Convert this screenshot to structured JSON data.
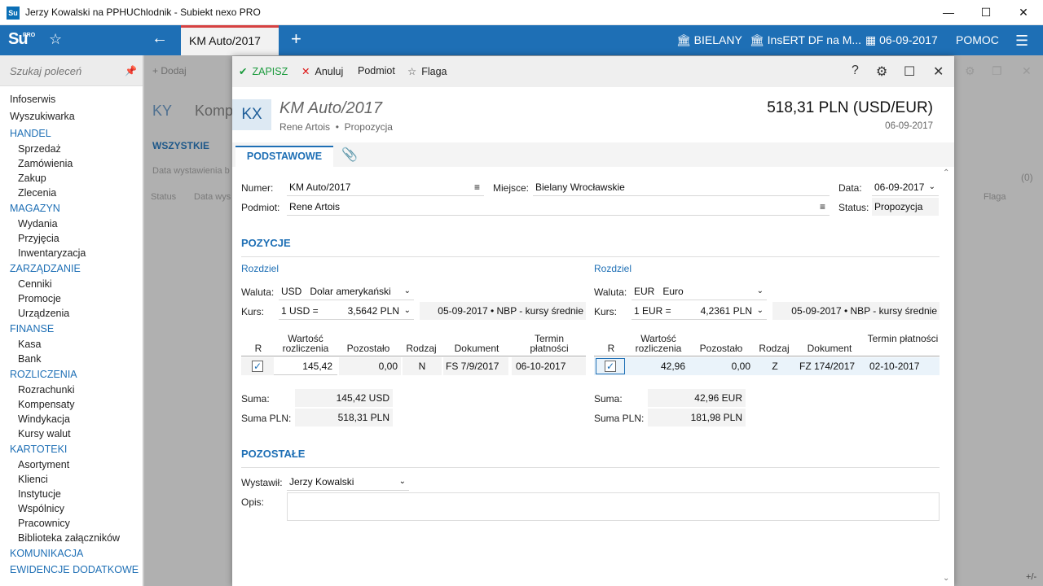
{
  "window": {
    "title": "Jerzy Kowalski na PPHUChlodnik - Subiekt nexo PRO",
    "app_icon": "Su",
    "controls": {
      "minimize": "—",
      "maximize": "☐",
      "close": "✕"
    }
  },
  "header": {
    "logo": "Su",
    "logo_sup": "PRO",
    "active_tab": "KM Auto/2017",
    "location": "BIELANY",
    "company": "InsERT DF na M...",
    "date": "06-09-2017",
    "help": "POMOC"
  },
  "sidebar": {
    "search_placeholder": "Szukaj poleceń",
    "items": [
      {
        "label": "Infoserwis",
        "kind": "top"
      },
      {
        "label": "Wyszukiwarka",
        "kind": "top"
      },
      {
        "label": "HANDEL",
        "kind": "cat"
      },
      {
        "label": "Sprzedaż",
        "kind": "sub"
      },
      {
        "label": "Zamówienia",
        "kind": "sub"
      },
      {
        "label": "Zakup",
        "kind": "sub"
      },
      {
        "label": "Zlecenia",
        "kind": "sub"
      },
      {
        "label": "MAGAZYN",
        "kind": "cat"
      },
      {
        "label": "Wydania",
        "kind": "sub"
      },
      {
        "label": "Przyjęcia",
        "kind": "sub"
      },
      {
        "label": "Inwentaryzacja",
        "kind": "sub"
      },
      {
        "label": "ZARZĄDZANIE",
        "kind": "cat"
      },
      {
        "label": "Cenniki",
        "kind": "sub"
      },
      {
        "label": "Promocje",
        "kind": "sub"
      },
      {
        "label": "Urządzenia",
        "kind": "sub"
      },
      {
        "label": "FINANSE",
        "kind": "cat"
      },
      {
        "label": "Kasa",
        "kind": "sub"
      },
      {
        "label": "Bank",
        "kind": "sub"
      },
      {
        "label": "ROZLICZENIA",
        "kind": "cat"
      },
      {
        "label": "Rozrachunki",
        "kind": "sub"
      },
      {
        "label": "Kompensaty",
        "kind": "sub"
      },
      {
        "label": "Windykacja",
        "kind": "sub"
      },
      {
        "label": "Kursy walut",
        "kind": "sub"
      },
      {
        "label": "KARTOTEKI",
        "kind": "cat"
      },
      {
        "label": "Asortyment",
        "kind": "sub"
      },
      {
        "label": "Klienci",
        "kind": "sub"
      },
      {
        "label": "Instytucje",
        "kind": "sub"
      },
      {
        "label": "Wspólnicy",
        "kind": "sub"
      },
      {
        "label": "Pracownicy",
        "kind": "sub"
      },
      {
        "label": "Biblioteka załączników",
        "kind": "sub"
      },
      {
        "label": "KOMUNIKACJA",
        "kind": "cat"
      },
      {
        "label": "EWIDENCJE DODATKOWE",
        "kind": "cat"
      }
    ]
  },
  "background": {
    "add": "Dodaj",
    "ky": "KY",
    "title": "Komp",
    "tab": "WSZYSTKIE",
    "filter": "Data wystawienia b",
    "col_status": "Status",
    "col_date": "Data wys",
    "col_flag": "Flaga",
    "count": "(0)"
  },
  "dialog": {
    "toolbar": {
      "save": "ZAPISZ",
      "cancel": "Anuluj",
      "subject": "Podmiot",
      "flag": "Flaga",
      "help": "?"
    },
    "badge": "KX",
    "title": "KM Auto/2017",
    "subtitle_party": "Rene Artois",
    "subtitle_status": "Propozycja",
    "amount": "518,31 PLN (USD/EUR)",
    "date": "06-09-2017",
    "tab_main": "PODSTAWOWE",
    "form": {
      "number_label": "Numer:",
      "number": "KM Auto/2017",
      "place_label": "Miejsce:",
      "place": "Bielany Wrocławskie",
      "date_label": "Data:",
      "date": "06-09-2017",
      "party_label": "Podmiot:",
      "party": "Rene Artois",
      "status_label": "Status:",
      "status": "Propozycja"
    },
    "positions": {
      "title": "POZYCJE",
      "left": {
        "split": "Rozdziel",
        "currency_label": "Waluta:",
        "currency_code": "USD",
        "currency_name": "Dolar amerykański",
        "rate_label": "Kurs:",
        "rate_unit": "1 USD =",
        "rate_value": "3,5642 PLN",
        "rate_info": "05-09-2017 • NBP - kursy średnie",
        "headers": [
          "R",
          "Wartość rozliczenia",
          "Pozostało",
          "Rodzaj",
          "Dokument",
          "Termin płatności"
        ],
        "row": {
          "checked": "✓",
          "value": "145,42",
          "remaining": "0,00",
          "kind": "N",
          "document": "FS 7/9/2017",
          "due": "06-10-2017"
        },
        "sum_label": "Suma:",
        "sum": "145,42 USD",
        "sum_pln_label": "Suma PLN:",
        "sum_pln": "518,31 PLN"
      },
      "right": {
        "split": "Rozdziel",
        "currency_label": "Waluta:",
        "currency_code": "EUR",
        "currency_name": "Euro",
        "rate_label": "Kurs:",
        "rate_unit": "1 EUR =",
        "rate_value": "4,2361 PLN",
        "rate_info": "05-09-2017 • NBP - kursy średnie",
        "headers": [
          "R",
          "Wartość rozliczenia",
          "Pozostało",
          "Rodzaj",
          "Dokument",
          "Termin płatności"
        ],
        "row": {
          "checked": "✓",
          "value": "42,96",
          "remaining": "0,00",
          "kind": "Z",
          "document": "FZ 174/2017",
          "due": "02-10-2017"
        },
        "sum_label": "Suma:",
        "sum": "42,96 EUR",
        "sum_pln_label": "Suma PLN:",
        "sum_pln": "181,98 PLN"
      }
    },
    "other": {
      "title": "POZOSTAŁE",
      "issuer_label": "Wystawił:",
      "issuer": "Jerzy Kowalski",
      "desc_label": "Opis:",
      "desc": ""
    }
  },
  "status_bar": {
    "zoom": "+/-"
  }
}
